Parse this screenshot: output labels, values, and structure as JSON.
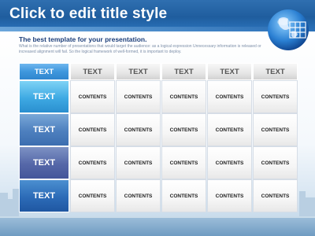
{
  "slide": {
    "title": "Click to edit title style",
    "subtitle": "The best template for your presentation.",
    "description": "What is the relative number of presentations that would target the audience: as a logical expression Unnecessary information is released or increased alignment will fail. So the logical framework of well-formed, it is important to deploy."
  },
  "table": {
    "corner_header": "TEXT",
    "column_headers": [
      "TEXT",
      "TEXT",
      "TEXT",
      "TEXT",
      "TEXT"
    ],
    "rows": [
      {
        "label": "TEXT",
        "cells": [
          "CONTENTS",
          "CONTENTS",
          "CONTENTS",
          "CONTENTS",
          "CONTENTS"
        ]
      },
      {
        "label": "TEXT",
        "cells": [
          "CONTENTS",
          "CONTENTS",
          "CONTENTS",
          "CONTENTS",
          "CONTENTS"
        ]
      },
      {
        "label": "TEXT",
        "cells": [
          "CONTENTS",
          "CONTENTS",
          "CONTENTS",
          "CONTENTS",
          "CONTENTS"
        ]
      },
      {
        "label": "TEXT",
        "cells": [
          "CONTENTS",
          "CONTENTS",
          "CONTENTS",
          "CONTENTS",
          "CONTENTS"
        ]
      }
    ]
  },
  "decor": {
    "globe_icon": "globe-icon",
    "skyline": "city-skyline",
    "accent_color": "#2f6fb0"
  }
}
